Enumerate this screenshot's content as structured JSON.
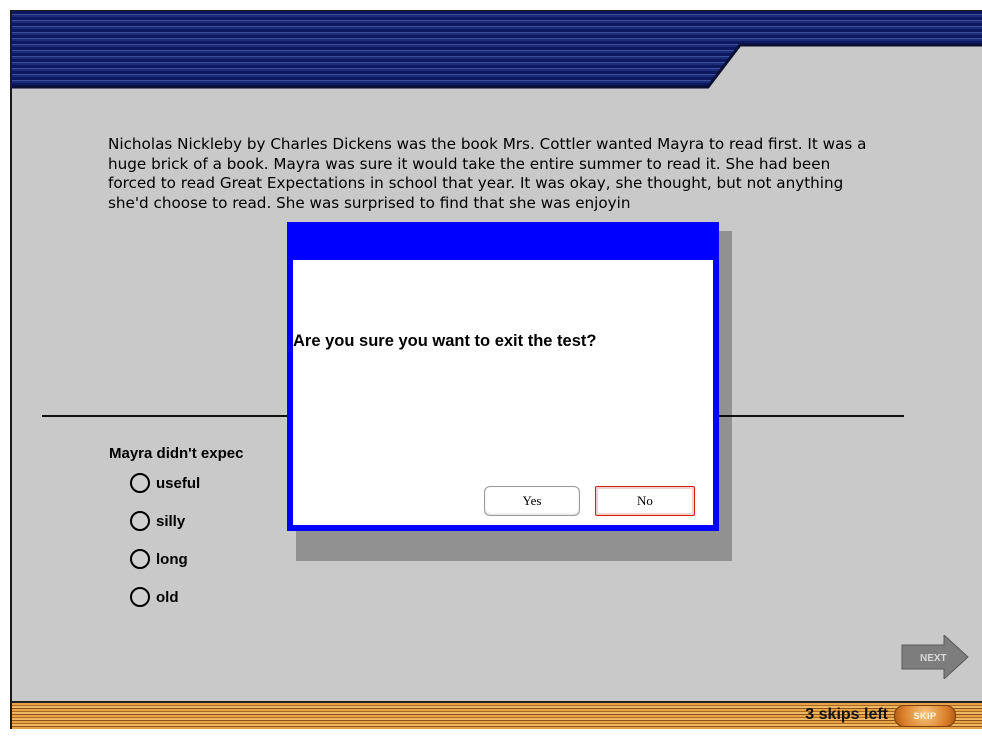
{
  "passage": {
    "text": "Nicholas Nickleby by Charles Dickens was the book Mrs. Cottler wanted Mayra to read first. It was a huge brick of a book. Mayra was sure it would take the entire summer to read it. She had been forced to read Great Expectations in school that year. It was okay, she thought, but not anything she'd choose to read. She was surprised to find that she was enjoyin"
  },
  "question": {
    "text": "Mayra didn't expec"
  },
  "options": [
    {
      "label": "useful"
    },
    {
      "label": "silly"
    },
    {
      "label": "long"
    },
    {
      "label": "old"
    }
  ],
  "next_button": {
    "label": "NEXT"
  },
  "footer": {
    "skips_left": "3 skips left",
    "skip_label": "SKIP"
  },
  "dialog": {
    "message": "Are you sure you want to exit the test?",
    "yes_label": "Yes",
    "no_label": "No"
  },
  "colors": {
    "dialog_border": "#0000ff",
    "banner_navy": "#0d1b5a",
    "footer_orange": "#e9a44a",
    "no_button_border": "#d21a1a"
  }
}
